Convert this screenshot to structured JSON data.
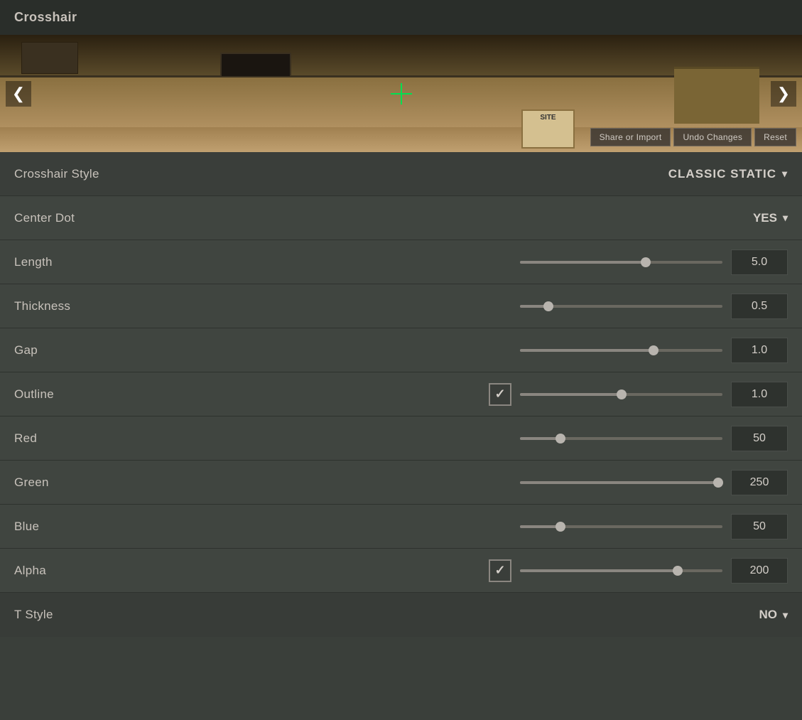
{
  "title": "Crosshair",
  "preview": {
    "nav_left": "❮",
    "nav_right": "❯",
    "buttons": {
      "share": "Share or Import",
      "undo": "Undo Changes",
      "reset": "Reset"
    },
    "sign_text": "SITE"
  },
  "settings": {
    "crosshair_style": {
      "label": "Crosshair Style",
      "value": "CLASSIC STATIC",
      "chevron": "▾"
    },
    "center_dot": {
      "label": "Center Dot",
      "value": "YES",
      "chevron": "▾"
    },
    "length": {
      "label": "Length",
      "value": "5.0",
      "slider_percent": 62
    },
    "thickness": {
      "label": "Thickness",
      "value": "0.5",
      "slider_percent": 14
    },
    "gap": {
      "label": "Gap",
      "value": "1.0",
      "slider_percent": 66
    },
    "outline": {
      "label": "Outline",
      "checked": true,
      "value": "1.0",
      "slider_percent": 50,
      "check_symbol": "✓"
    },
    "red": {
      "label": "Red",
      "value": "50",
      "slider_percent": 20
    },
    "green": {
      "label": "Green",
      "value": "250",
      "slider_percent": 98
    },
    "blue": {
      "label": "Blue",
      "value": "50",
      "slider_percent": 20
    },
    "alpha": {
      "label": "Alpha",
      "checked": true,
      "value": "200",
      "slider_percent": 78,
      "check_symbol": "✓"
    },
    "t_style": {
      "label": "T Style",
      "value": "NO",
      "chevron": "▾"
    }
  }
}
